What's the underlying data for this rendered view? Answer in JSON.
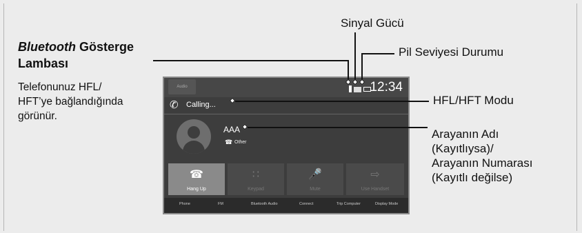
{
  "callouts": {
    "signal_strength": "Sinyal Gücü",
    "battery_level": "Pil Seviyesi Durumu",
    "bt_title_italic": "Bluetooth",
    "bt_title_rest": " Gösterge",
    "bt_title_line2": "Lambası",
    "bt_desc_1": "Telefonunuz HFL/",
    "bt_desc_2": "HFT’ye bağlandığında",
    "bt_desc_3": "görünür.",
    "hfl_mode": "HFL/HFT Modu",
    "caller_1": "Arayanın Adı",
    "caller_2": "(Kayıtlıysa)/",
    "caller_3": "Arayanın Numarası",
    "caller_4": "(Kayıtlı değilse)"
  },
  "screen": {
    "time": "12:34",
    "audio_label": "Audio",
    "calling": "Calling...",
    "caller_name": "AAA",
    "caller_type": "Other",
    "buttons": [
      "Hang Up",
      "Keypad",
      "Mute",
      "Use Handset"
    ],
    "nav": [
      "Phone",
      "FM",
      "Bluetooth Audio",
      "Connect",
      "Trip Computer",
      "Display Mode"
    ]
  },
  "icons": [
    "phone-icon",
    "bluetooth-icon",
    "signal-icon",
    "battery-icon",
    "avatar-icon",
    "hang-up-icon",
    "keypad-icon",
    "mute-icon",
    "handset-icon"
  ]
}
